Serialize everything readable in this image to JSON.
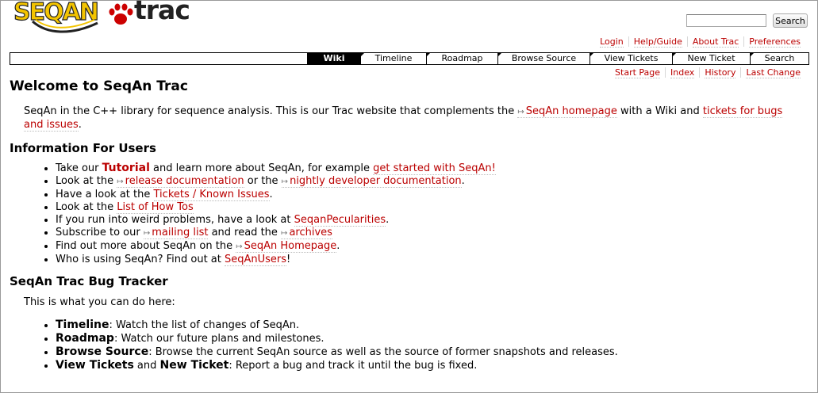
{
  "logo": {
    "seqan": "SEQAN",
    "trac": "trac"
  },
  "search": {
    "placeholder": "",
    "button_label": "Search"
  },
  "metanav": [
    "Login",
    "Help/Guide",
    "About Trac",
    "Preferences"
  ],
  "mainnav": [
    {
      "label": "Wiki",
      "active": true
    },
    {
      "label": "Timeline",
      "active": false
    },
    {
      "label": "Roadmap",
      "active": false
    },
    {
      "label": "Browse Source",
      "active": false
    },
    {
      "label": "View Tickets",
      "active": false
    },
    {
      "label": "New Ticket",
      "active": false
    },
    {
      "label": "Search",
      "active": false
    }
  ],
  "ctxtnav": [
    "Start Page",
    "Index",
    "History",
    "Last Change"
  ],
  "page": {
    "title": "Welcome to SeqAn Trac",
    "intro": {
      "t1": "SeqAn in the C++ library for sequence analysis. This is our Trac website that complements the ",
      "link1": "SeqAn homepage",
      "t2": " with a Wiki and ",
      "link2": "tickets for bugs and issues",
      "t3": "."
    },
    "users_heading": "Information For Users",
    "users": {
      "i1": {
        "t1": "Take our ",
        "link1": "Tutorial",
        "t2": " and learn more about SeqAn, for example ",
        "link2": "get started with SeqAn!"
      },
      "i2": {
        "t1": "Look at the ",
        "link1": "release documentation",
        "t2": " or the ",
        "link2": "nightly developer documentation",
        "t3": "."
      },
      "i3": {
        "t1": "Have a look at the ",
        "link1": "Tickets / Known Issues",
        "t2": "."
      },
      "i4": {
        "t1": "Look at the ",
        "link1": "List of How Tos"
      },
      "i5": {
        "t1": "If you run into weird problems, have a look at ",
        "link1": "SeqanPecularities",
        "t2": "."
      },
      "i6": {
        "t1": "Subscribe to our ",
        "link1": "mailing list",
        "t2": " and read the ",
        "link2": "archives"
      },
      "i7": {
        "t1": "Find out more about SeqAn on the ",
        "link1": "SeqAn Homepage",
        "t2": "."
      },
      "i8": {
        "t1": "Who is using SeqAn? Find out at ",
        "link1": "SeqAnUsers",
        "t2": "!"
      }
    },
    "bug_heading": "SeqAn Trac Bug Tracker",
    "bug_intro": "This is what you can do here:",
    "bug": {
      "i1": {
        "b1": "Timeline",
        "t1": ": Watch the list of changes of SeqAn."
      },
      "i2": {
        "b1": "Roadmap",
        "t1": ": Watch our future plans and milestones."
      },
      "i3": {
        "b1": "Browse Source",
        "t1": ": Browse the current SeqAn source as well as the source of former snapshots and releases."
      },
      "i4": {
        "b1": "View Tickets",
        "t1": " and ",
        "b2": "New Ticket",
        "t2": ": Report a bug and track it until the bug is fixed."
      }
    }
  }
}
